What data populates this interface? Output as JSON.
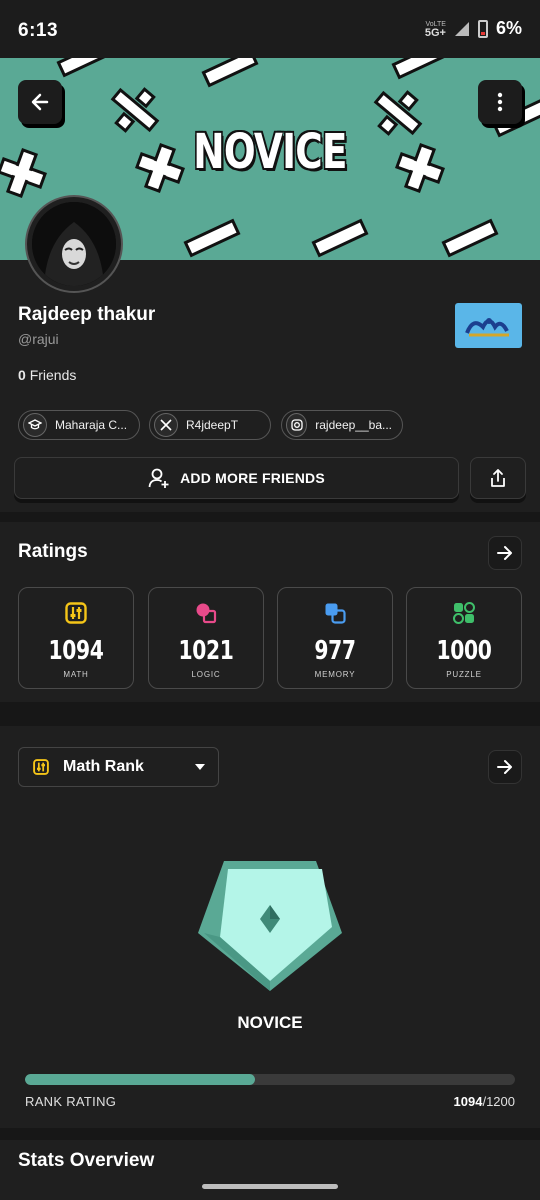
{
  "status_bar": {
    "time": "6:13",
    "network_top": "VoLTE",
    "network": "5G+",
    "battery": "6%"
  },
  "banner": {
    "title": "NOVICE",
    "bg_color": "#5aa995"
  },
  "profile": {
    "name": "Rajdeep thakur",
    "handle": "@rajui",
    "friends_count": "0",
    "friends_label": "Friends",
    "team_badge": "Mumbai Indians"
  },
  "chips": [
    {
      "icon": "graduation-cap-icon",
      "label": "Maharaja C..."
    },
    {
      "icon": "x-logo-icon",
      "label": "R4jdeepT"
    },
    {
      "icon": "instagram-icon",
      "label": "rajdeep__ba..."
    }
  ],
  "actions": {
    "add_friends": "ADD MORE FRIENDS"
  },
  "ratings": {
    "title": "Ratings",
    "items": [
      {
        "value": "1094",
        "label": "MATH",
        "icon": "sliders-icon",
        "color": "#f5c518"
      },
      {
        "value": "1021",
        "label": "LOGIC",
        "icon": "shapes-icon",
        "color": "#e84a8a"
      },
      {
        "value": "977",
        "label": "MEMORY",
        "icon": "layers-icon",
        "color": "#4a9cf0"
      },
      {
        "value": "1000",
        "label": "PUZZLE",
        "icon": "grid-icon",
        "color": "#3fbf6a"
      }
    ]
  },
  "rank": {
    "selector": "Math Rank",
    "name": "NOVICE",
    "rating_label": "RANK RATING",
    "current": "1094",
    "max": "/1200",
    "progress": 0.47,
    "accent": "#5aa995"
  },
  "stats": {
    "title": "Stats Overview"
  }
}
